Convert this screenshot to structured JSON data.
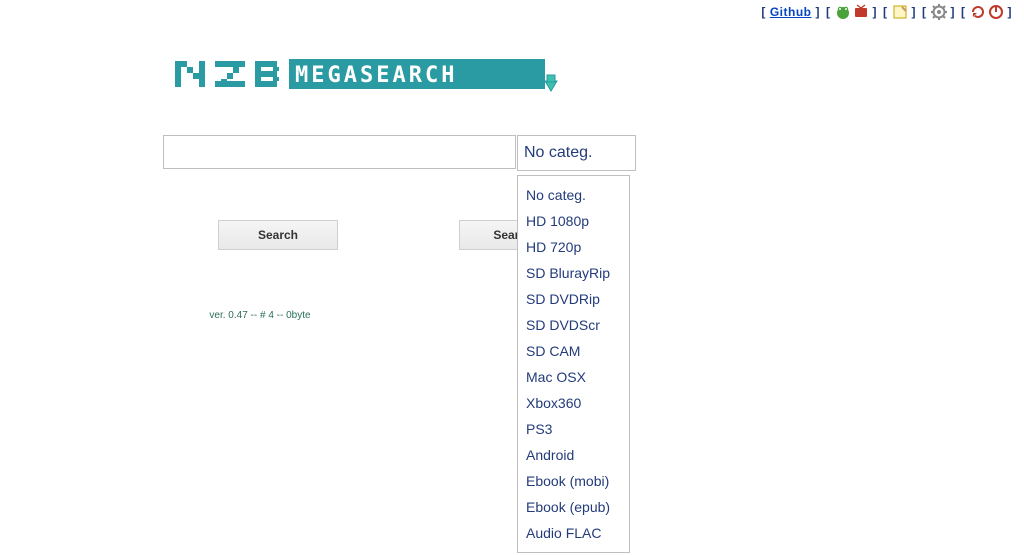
{
  "topbar": {
    "github": "Github"
  },
  "logo": {
    "left": "NZB",
    "right": "MEGASEARCH"
  },
  "search": {
    "value": "",
    "placeholder": ""
  },
  "category": {
    "selected": "No categ.",
    "options": [
      "No categ.",
      "HD 1080p",
      "HD 720p",
      "SD BlurayRip",
      "SD DVDRip",
      "SD DVDScr",
      "SD CAM",
      "Mac OSX",
      "Xbox360",
      "PS3",
      "Android",
      "Ebook (mobi)",
      "Ebook (epub)",
      "Audio FLAC"
    ]
  },
  "buttons": {
    "search": "Search",
    "search_ext": "Search E"
  },
  "footer": {
    "version": "ver. 0.47 -- # 4 -- 0byte"
  }
}
